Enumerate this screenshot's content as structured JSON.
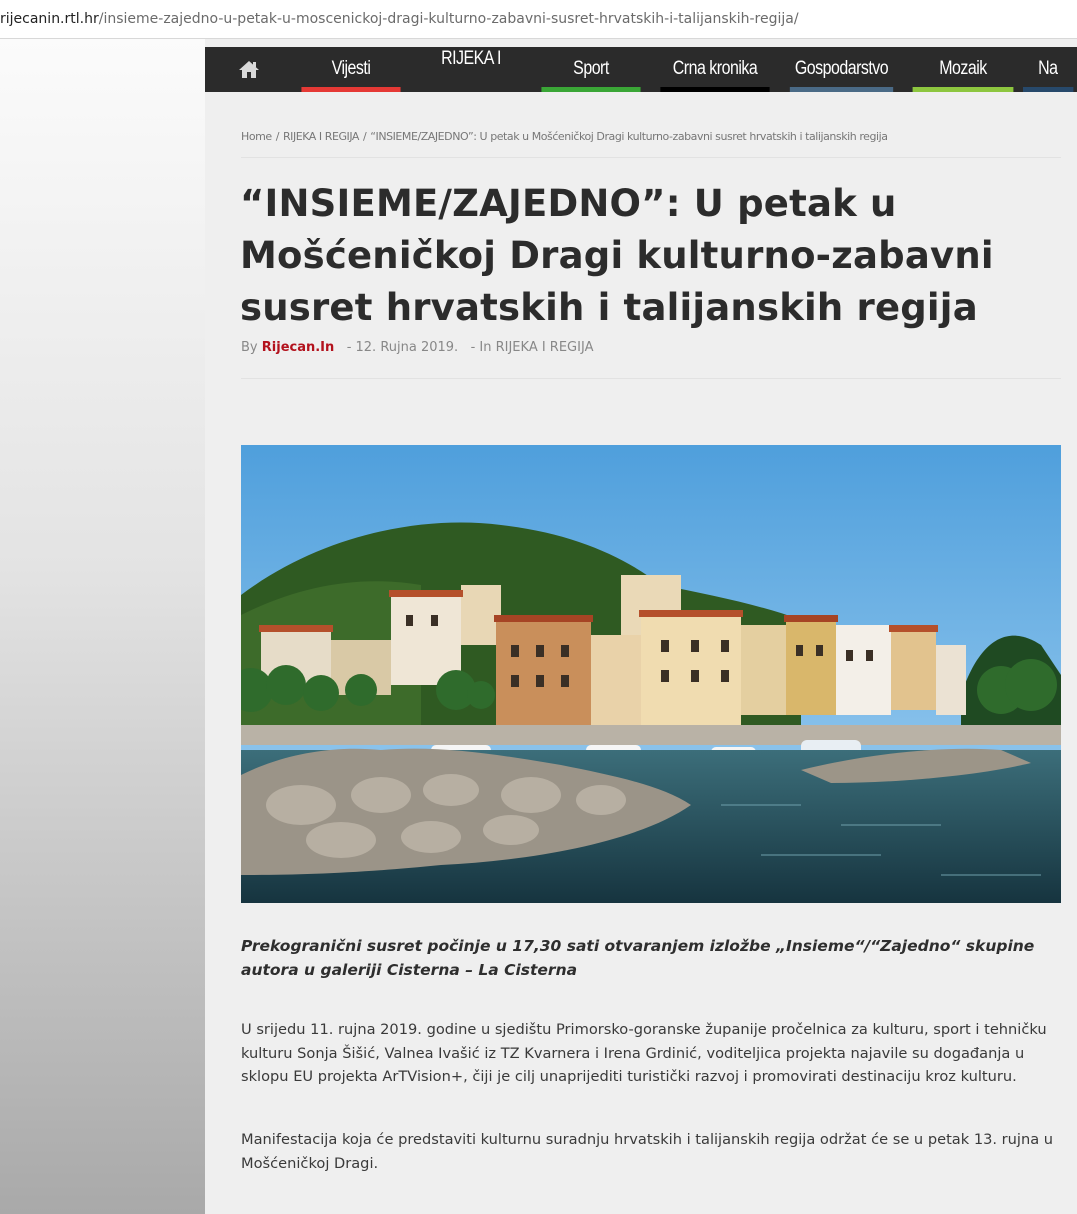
{
  "url": {
    "domain": "rijecanin.rtl.hr",
    "path": "/insieme-zajedno-u-petak-u-moscenickoj-dragi-kulturno-zabavni-susret-hrvatskih-i-talijanskih-regija/"
  },
  "nav": {
    "items": [
      {
        "label": "Vijesti",
        "bar_color": "#e53935"
      },
      {
        "label": "RIJEKA I",
        "bar_color": ""
      },
      {
        "label": "Sport",
        "bar_color": "#3aa636"
      },
      {
        "label": "Crna kronika",
        "bar_color": "#000000"
      },
      {
        "label": "Gospodarstvo",
        "bar_color": "#4a6a86"
      },
      {
        "label": "Mozaik",
        "bar_color": "#8dc63f"
      },
      {
        "label": "Na",
        "bar_color": "#27496b"
      }
    ]
  },
  "breadcrumb": {
    "home": "Home",
    "sep": "/",
    "category": "RIJEKA I REGIJA",
    "current": "“INSIEME/ZAJEDNO”: U petak u Mošćeničkoj Dragi kulturno-zabavni susret hrvatskih i talijanskih regija"
  },
  "article": {
    "title": "“INSIEME/ZAJEDNO”: U petak u Mošćeničkoj Dragi kulturno-zabavni susret hrvatskih i talijanskih regija",
    "meta": {
      "by": "By",
      "author": "Rijecan.In",
      "date": "- 12. Rujna 2019.",
      "category": "- In RIJEKA I REGIJA"
    },
    "lead": "Prekogranični susret počinje u 17,30 sati otvaranjem izložbe „Insieme“/“Zajedno“ skupine autora u galeriji Cisterna – La Cisterna",
    "paragraphs": [
      "U srijedu 11. rujna 2019. godine u sjedištu Primorsko-goranske županije pročelnica za kulturu, sport i tehničku kulturu Sonja Šišić, Valnea Ivašić iz TZ Kvarnera i Irena Grdinić, voditeljica projekta najavile su događanja u sklopu EU projekta ArTVision+, čiji je cilj unaprijediti turistički razvoj i promovirati destinaciju kroz kulturu.",
      "Manifestacija koja će predstaviti kulturnu suradnju hrvatskih i talijanskih regija održat će se u petak 13. rujna u Mošćeničkoj Dragi."
    ]
  },
  "icons": {
    "home": "home-icon"
  }
}
